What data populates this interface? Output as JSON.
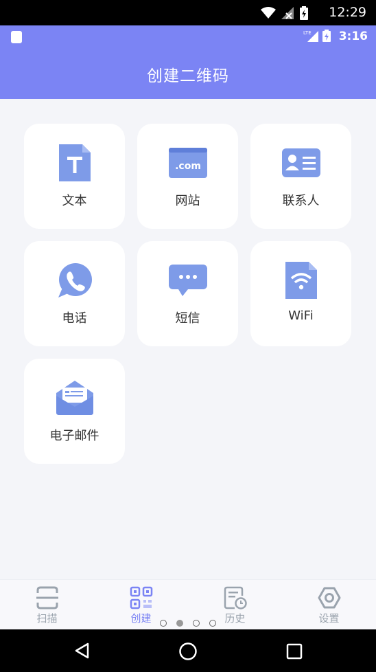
{
  "system_status": {
    "time": "12:29"
  },
  "app_status": {
    "time": "3:16",
    "network": "LTE"
  },
  "header": {
    "title": "创建二维码"
  },
  "cards": [
    {
      "label": "文本",
      "icon": "text-document-icon"
    },
    {
      "label": "网站",
      "icon": "website-com-icon"
    },
    {
      "label": "联系人",
      "icon": "contact-card-icon"
    },
    {
      "label": "电话",
      "icon": "phone-icon"
    },
    {
      "label": "短信",
      "icon": "sms-bubble-icon"
    },
    {
      "label": "WiFi",
      "icon": "wifi-file-icon"
    },
    {
      "label": "电子邮件",
      "icon": "email-envelope-icon"
    }
  ],
  "bottom_nav": [
    {
      "label": "扫描",
      "icon": "scan-icon"
    },
    {
      "label": "创建",
      "icon": "qr-code-icon",
      "active": true
    },
    {
      "label": "历史",
      "icon": "history-icon"
    },
    {
      "label": "设置",
      "icon": "settings-icon"
    }
  ],
  "colors": {
    "accent": "#7b84f4",
    "icon": "#7e9be8",
    "inactive": "#9aa3ad"
  }
}
